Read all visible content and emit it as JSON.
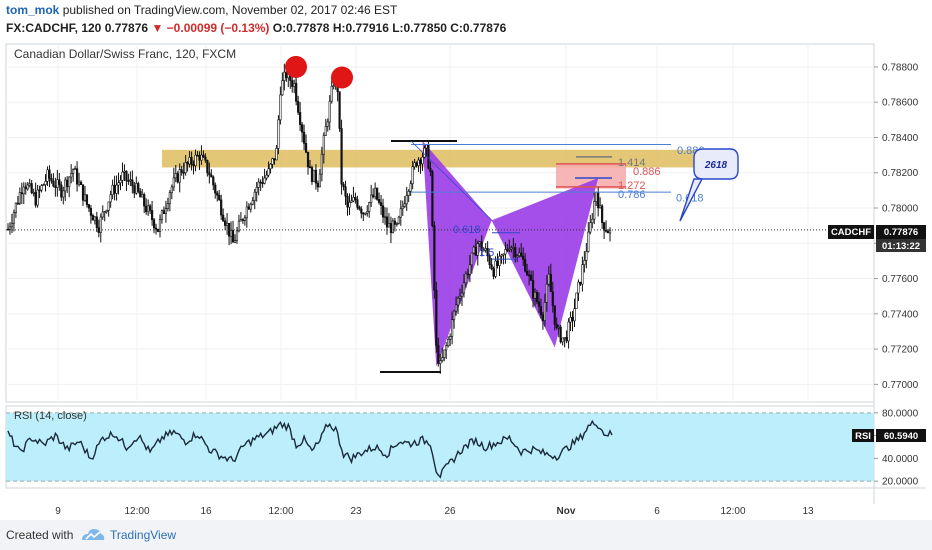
{
  "header": {
    "author": "tom_mok",
    "published": "published on TradingView.com, November 02, 2017 02:46 EST",
    "symbol": "FX:CADCHF, 120",
    "last": "0.77876",
    "change": "−0.00099 (−0.13%)",
    "open": "O:0.77878",
    "high": "H:0.77916",
    "low": "L:0.77850",
    "close": "C:0.77876"
  },
  "footer": {
    "created_with": "Created with",
    "brand": "TradingView"
  },
  "colors": {
    "up": "#000000",
    "pattern": "#9b3ce8",
    "zone": "#d9b44a",
    "rsi_band": "#bdeefb",
    "fib_blue": "#4a7fd6",
    "fib_red": "#e05555",
    "marker": "#e01515"
  },
  "chart_data": [
    {
      "type": "candlestick",
      "title": "Canadian Dollar/Swiss Franc, 120, FXCM",
      "ylim": [
        0.769,
        0.7893
      ],
      "y_ticks": [
        "0.78800",
        "0.78600",
        "0.78400",
        "0.78200",
        "0.78000",
        "0.77800",
        "0.77600",
        "0.77400",
        "0.77200",
        "0.77000"
      ],
      "x_ticks": [
        "9",
        "12:00",
        "16",
        "12:00",
        "23",
        "26",
        "Nov",
        "6",
        "12:00",
        "13"
      ],
      "last_price_label": "CADCHF",
      "last_price": "0.77876",
      "countdown": "01:13:22",
      "price_anchors": [
        [
          0,
          0.7788
        ],
        [
          8,
          0.7815
        ],
        [
          14,
          0.7805
        ],
        [
          20,
          0.7818
        ],
        [
          27,
          0.781
        ],
        [
          33,
          0.7822
        ],
        [
          40,
          0.7802
        ],
        [
          46,
          0.779
        ],
        [
          52,
          0.7808
        ],
        [
          58,
          0.7818
        ],
        [
          64,
          0.7812
        ],
        [
          70,
          0.78
        ],
        [
          76,
          0.7788
        ],
        [
          82,
          0.781
        ],
        [
          88,
          0.7822
        ],
        [
          92,
          0.7825
        ],
        [
          97,
          0.783
        ],
        [
          102,
          0.782
        ],
        [
          108,
          0.78
        ],
        [
          114,
          0.778
        ],
        [
          120,
          0.7798
        ],
        [
          126,
          0.7812
        ],
        [
          132,
          0.782
        ],
        [
          136,
          0.7832
        ],
        [
          138,
          0.7868
        ],
        [
          141,
          0.7876
        ],
        [
          145,
          0.787
        ],
        [
          149,
          0.7845
        ],
        [
          153,
          0.782
        ],
        [
          157,
          0.7815
        ],
        [
          161,
          0.7845
        ],
        [
          165,
          0.7872
        ],
        [
          167,
          0.7868
        ],
        [
          169,
          0.7815
        ],
        [
          172,
          0.78
        ],
        [
          176,
          0.7805
        ],
        [
          180,
          0.7798
        ],
        [
          186,
          0.7808
        ],
        [
          192,
          0.779
        ],
        [
          197,
          0.7788
        ],
        [
          202,
          0.781
        ],
        [
          207,
          0.7827
        ],
        [
          212,
          0.7832
        ],
        [
          214,
          0.782
        ],
        [
          217,
          0.772
        ],
        [
          219,
          0.771
        ],
        [
          223,
          0.7725
        ],
        [
          227,
          0.7745
        ],
        [
          233,
          0.7765
        ],
        [
          238,
          0.778
        ],
        [
          242,
          0.7775
        ],
        [
          246,
          0.7765
        ],
        [
          250,
          0.777
        ],
        [
          254,
          0.778
        ],
        [
          258,
          0.7775
        ],
        [
          262,
          0.7768
        ],
        [
          266,
          0.7752
        ],
        [
          271,
          0.774
        ],
        [
          274,
          0.776
        ],
        [
          278,
          0.773
        ],
        [
          282,
          0.7725
        ],
        [
          286,
          0.7738
        ],
        [
          290,
          0.776
        ],
        [
          294,
          0.7783
        ],
        [
          298,
          0.781
        ],
        [
          301,
          0.7792
        ],
        [
          305,
          0.7786
        ],
        [
          306,
          0.7788
        ]
      ],
      "annotations": {
        "fib_labels": [
          "0.886",
          "1.414",
          "0.886",
          "1.272",
          "0.786",
          "0.618",
          "0.618",
          "1.5"
        ],
        "callout": "2618",
        "markers": 2
      }
    },
    {
      "type": "line",
      "title": "RSI (14, close)",
      "ylim": [
        14,
        86
      ],
      "y_ticks": [
        "80.0000",
        "60.0000",
        "40.0000",
        "20.0000"
      ],
      "band": [
        20,
        80
      ],
      "last_label": "RSI",
      "last_value": "60.5940",
      "rsi_anchors": [
        [
          0,
          62
        ],
        [
          6,
          45
        ],
        [
          12,
          58
        ],
        [
          18,
          52
        ],
        [
          24,
          60
        ],
        [
          30,
          48
        ],
        [
          36,
          55
        ],
        [
          42,
          40
        ],
        [
          48,
          58
        ],
        [
          54,
          62
        ],
        [
          60,
          50
        ],
        [
          66,
          60
        ],
        [
          72,
          45
        ],
        [
          78,
          58
        ],
        [
          84,
          63
        ],
        [
          90,
          55
        ],
        [
          96,
          62
        ],
        [
          102,
          48
        ],
        [
          108,
          42
        ],
        [
          114,
          38
        ],
        [
          120,
          52
        ],
        [
          126,
          58
        ],
        [
          132,
          62
        ],
        [
          138,
          70
        ],
        [
          142,
          68
        ],
        [
          146,
          52
        ],
        [
          150,
          56
        ],
        [
          154,
          46
        ],
        [
          158,
          55
        ],
        [
          162,
          70
        ],
        [
          166,
          66
        ],
        [
          170,
          44
        ],
        [
          174,
          40
        ],
        [
          180,
          46
        ],
        [
          186,
          50
        ],
        [
          192,
          44
        ],
        [
          198,
          55
        ],
        [
          204,
          53
        ],
        [
          210,
          56
        ],
        [
          214,
          54
        ],
        [
          217,
          30
        ],
        [
          219,
          25
        ],
        [
          224,
          36
        ],
        [
          230,
          48
        ],
        [
          236,
          56
        ],
        [
          242,
          50
        ],
        [
          248,
          54
        ],
        [
          254,
          58
        ],
        [
          260,
          46
        ],
        [
          266,
          48
        ],
        [
          272,
          44
        ],
        [
          278,
          42
        ],
        [
          284,
          50
        ],
        [
          290,
          58
        ],
        [
          294,
          68
        ],
        [
          298,
          72
        ],
        [
          302,
          62
        ],
        [
          306,
          61
        ]
      ]
    }
  ]
}
